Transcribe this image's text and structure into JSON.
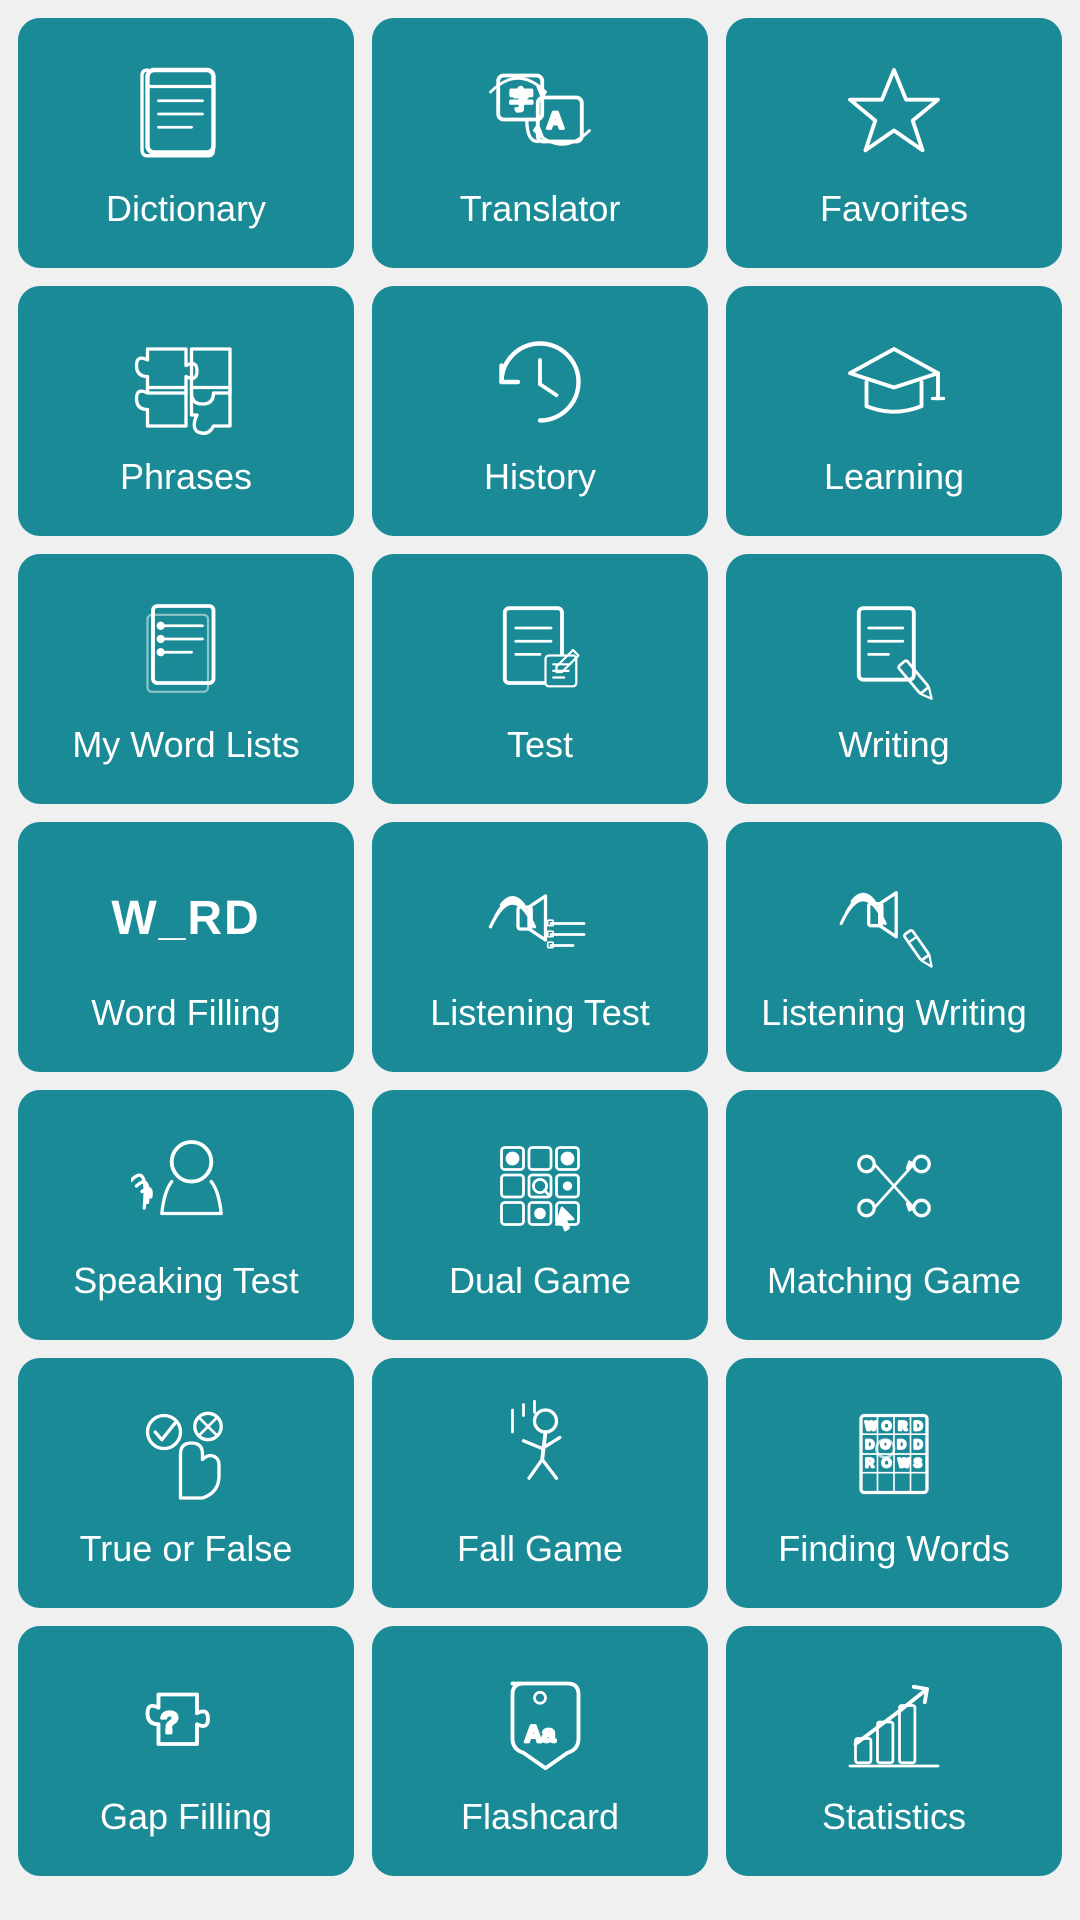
{
  "cards": [
    {
      "id": "dictionary",
      "label": "Dictionary",
      "icon": "dictionary"
    },
    {
      "id": "translator",
      "label": "Translator",
      "icon": "translator"
    },
    {
      "id": "favorites",
      "label": "Favorites",
      "icon": "favorites"
    },
    {
      "id": "phrases",
      "label": "Phrases",
      "icon": "phrases"
    },
    {
      "id": "history",
      "label": "History",
      "icon": "history"
    },
    {
      "id": "learning",
      "label": "Learning",
      "icon": "learning"
    },
    {
      "id": "my-word-lists",
      "label": "My Word Lists",
      "icon": "wordlists"
    },
    {
      "id": "test",
      "label": "Test",
      "icon": "test"
    },
    {
      "id": "writing",
      "label": "Writing",
      "icon": "writing"
    },
    {
      "id": "word-filling",
      "label": "Word Filling",
      "icon": "wordfilling"
    },
    {
      "id": "listening-test",
      "label": "Listening Test",
      "icon": "listeningtest"
    },
    {
      "id": "listening-writing",
      "label": "Listening Writing",
      "icon": "listeningwriting"
    },
    {
      "id": "speaking-test",
      "label": "Speaking Test",
      "icon": "speakingtest"
    },
    {
      "id": "dual-game",
      "label": "Dual Game",
      "icon": "dualgame"
    },
    {
      "id": "matching-game",
      "label": "Matching Game",
      "icon": "matchinggame"
    },
    {
      "id": "true-or-false",
      "label": "True or False",
      "icon": "trueorfalse"
    },
    {
      "id": "fall-game",
      "label": "Fall Game",
      "icon": "fallgame"
    },
    {
      "id": "finding-words",
      "label": "Finding Words",
      "icon": "findingwords"
    },
    {
      "id": "gap-filling",
      "label": "Gap Filling",
      "icon": "gapfilling"
    },
    {
      "id": "flashcard",
      "label": "Flashcard",
      "icon": "flashcard"
    },
    {
      "id": "statistics",
      "label": "Statistics",
      "icon": "statistics"
    }
  ]
}
